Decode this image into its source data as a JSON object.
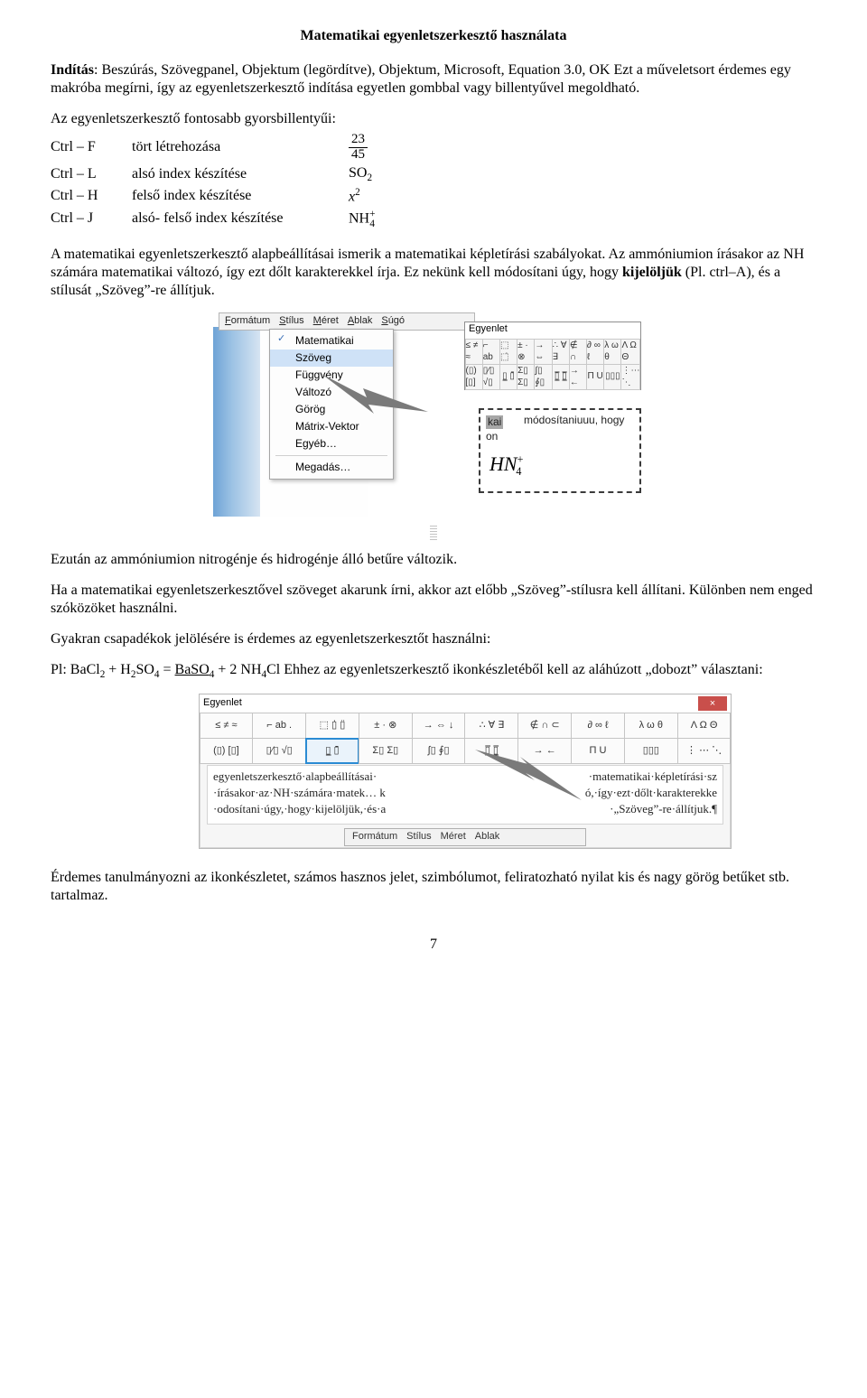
{
  "title": "Matematikai egyenletszerkesztő használata",
  "p1_prefix": "Indítás",
  "p1_rest": ": Beszúrás, Szövegpanel, Objektum (legördítve), Objektum, Microsoft, Equation 3.0, OK Ezt a műveletsort érdemes egy makróba megírni, így az egyenletszerkesztő indítása egyetlen gombbal vagy billentyűvel megoldható.",
  "shortcuts_intro": "Az egyenletszerkesztő fontosabb gyorsbillentyűi:",
  "shortcuts": [
    {
      "key": "Ctrl – F",
      "desc": "tört létrehozása",
      "ex": {
        "type": "frac",
        "num": "23",
        "den": "45"
      }
    },
    {
      "key": "Ctrl – L",
      "desc": "alsó index készítése",
      "ex": {
        "type": "sub",
        "base": "SO",
        "sub": "2"
      }
    },
    {
      "key": "Ctrl – H",
      "desc": "felső index készítése",
      "ex": {
        "type": "sup",
        "base": "x",
        "sup": "2",
        "italic": true
      }
    },
    {
      "key": "Ctrl – J",
      "desc": "alsó- felső index készítése",
      "ex": {
        "type": "both",
        "base": "NH",
        "sub": "4",
        "sup": "+"
      }
    }
  ],
  "p2": "A matematikai egyenletszerkesztő alapbeállításai ismerik a matematikai képletírási szabályokat. Az ammóniumion írásakor az NH számára matematikai változó, így ezt dőlt karakterekkel írja. Ez nekünk kell módosítani úgy, hogy ",
  "p2_bold": "kijelöljük",
  "p2_after": " (Pl. ctrl–A), és a stílusát „Szöveg”-re állítjuk.",
  "fig1": {
    "menubar": [
      "Formátum",
      "Stílus",
      "Méret",
      "Ablak",
      "Súgó"
    ],
    "dropdown": [
      "Matematikai",
      "Szöveg",
      "Függvény",
      "Változó",
      "Görög",
      "Mátrix-Vektor",
      "Egyéb…",
      "Megadás…"
    ],
    "dropdown_checked_index": 0,
    "dropdown_hover_index": 1,
    "eqbar_title": "Egyenlet",
    "toolbar_row1": [
      "≤ ≠ ≈",
      "⌐ ab",
      "⬚ ⬚̇",
      "± · ⊗",
      "→ ⇔",
      "∴ ∀ ∃",
      "∉ ∩",
      "∂ ∞ ℓ",
      "λ ω θ",
      "Λ Ω Θ"
    ],
    "toolbar_row2": [
      "(▯) [▯]",
      "▯⁄▯ √▯",
      "▯̲ ▯̄",
      "Σ▯ Σ▯",
      "∫▯ ∮▯",
      "▯̲̅ ▯̲̅",
      "→ ←",
      "Π U",
      "▯▯▯",
      "⋮⋯⋱"
    ],
    "selection_line1": "kai",
    "selection_line2": "on",
    "selection_line3": "módosítaniuuu, hogy",
    "selection_eq_base": "HN",
    "selection_eq_sub": "4",
    "selection_eq_sup": "+"
  },
  "p3": "Ezután az ammóniumion nitrogénje és hidrogénje álló betűre változik.",
  "p4": "Ha a matematikai egyenletszerkesztővel szöveget akarunk írni, akkor azt előbb „Szöveg”-stílusra kell állítani. Különben nem enged szóközöket használni.",
  "p5": "Gyakran csapadékok jelölésére is érdemes az egyenletszerkesztőt használni:",
  "p6_lead": "Pl: ",
  "equation": {
    "segments": [
      {
        "t": "BaCl",
        "sub": "2"
      },
      {
        "t": " + H",
        "sub": "2"
      },
      {
        "t": "SO",
        "sub": "4"
      },
      {
        "t": " = "
      },
      {
        "t": "BaSO",
        "sub": "4",
        "underline": true
      },
      {
        "t": " + 2 NH",
        "sub": "4"
      },
      {
        "t": "Cl"
      }
    ]
  },
  "p6_rest": "  Ehhez az egyenletszerkesztő ikonkészletéből kell az aláhúzott „dobozt” választani:",
  "fig2": {
    "title": "Egyenlet",
    "close": "×",
    "row1": [
      "≤ ≠ ≈",
      "⌐ ab .",
      "⬚ ▯̇ ▯̈",
      "± · ⊗",
      "→ ⇔ ↓",
      "∴ ∀ ∃",
      "∉ ∩ ⊂",
      "∂ ∞ ℓ",
      "λ ω θ",
      "Λ Ω Θ"
    ],
    "row2": [
      "(▯) [▯]",
      "▯⁄▯ √▯",
      "▯̲  ▯̄",
      "Σ▯ Σ▯",
      "∫▯ ∮▯",
      "▯̲̅  ▯̲̅",
      "→  ←",
      "Π  U",
      "▯▯▯",
      "⋮ ⋯ ⋱"
    ],
    "highlight_row": 1,
    "highlight_col": 2,
    "body_lines_left": [
      "egyenletszerkesztő·alapbeállításai·",
      "·írásakor·az·NH·számára·matek… k",
      "·odosítani·úgy,·hogy·kijelöljük,·és·a"
    ],
    "body_lines_right": [
      "·matematikai·képletírási·sz",
      "ó,·így·ezt·dőlt·karakterekke",
      "·„Szöveg”-re·állítjuk.¶"
    ],
    "submenubar": [
      "Formátum",
      "Stílus",
      "Méret",
      "Ablak"
    ]
  },
  "p7": "Érdemes tanulmányozni az ikonkészletet, számos hasznos jelet, szimbólumot, feliratozható nyilat kis és nagy görög betűket stb. tartalmaz.",
  "page_number": "7"
}
